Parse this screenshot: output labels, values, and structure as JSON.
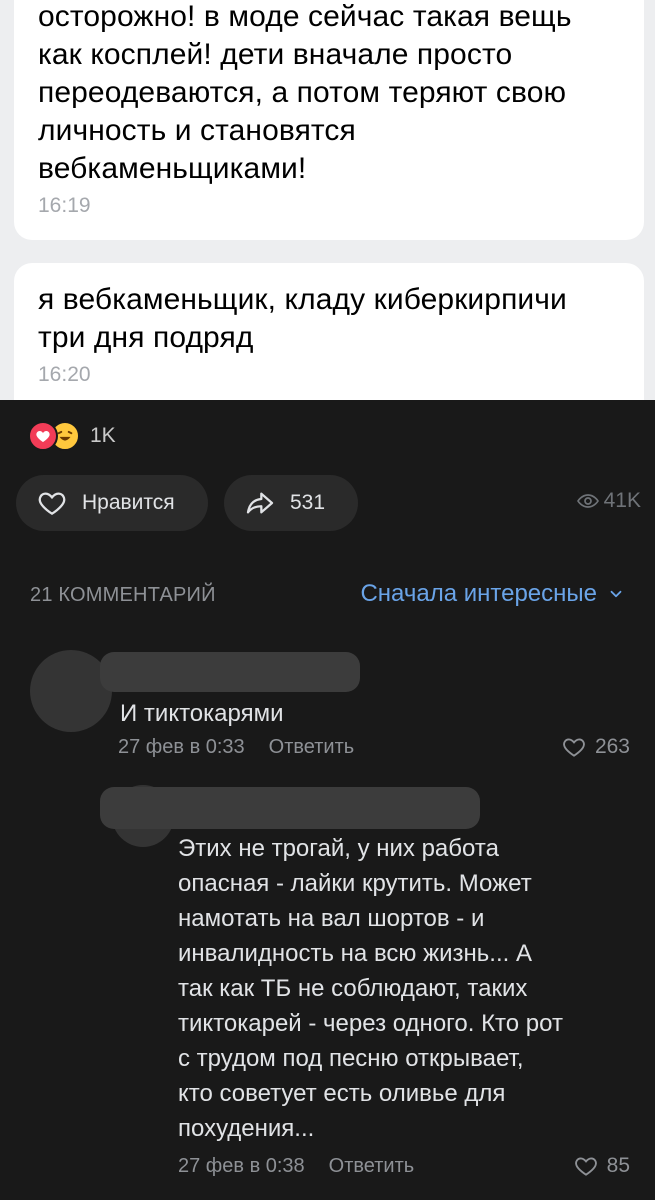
{
  "chat": {
    "messages": [
      {
        "lines": [
          "осторожно! в моде сейчас такая вещь",
          "как косплей! дети вначале просто",
          "переодеваются, а потом теряют свою",
          "личность и становятся",
          "вебкаменьщиками!"
        ],
        "time": "16:19"
      },
      {
        "lines": [
          "я вебкаменьщик, кладу киберкирпичи",
          "три дня подряд"
        ],
        "time": "16:20"
      }
    ]
  },
  "post": {
    "reactions_count": "1K",
    "like_label": "Нравится",
    "share_count": "531",
    "views": "41K"
  },
  "comments_section": {
    "count_label": "21 КОММЕНТАРИЙ",
    "sort_label": "Сначала интересные",
    "comments": [
      {
        "text": "И тиктокарями",
        "date": "27 фев в 0:33",
        "reply_label": "Ответить",
        "likes": "263"
      },
      {
        "lines": [
          "Этих не трогай, у них работа",
          "опасная - лайки крутить. Может",
          "намотать на вал шортов - и",
          "инвалидность на всю жизнь... А",
          "так как ТБ не соблюдают, таких",
          "тиктокарей - через одного. Кто рот",
          "с трудом под песню открывает,",
          "кто советует есть оливье для",
          "похудения..."
        ],
        "date": "27 фев в 0:38",
        "reply_label": "Ответить",
        "likes": "85"
      }
    ]
  },
  "colors": {
    "background": "#191919",
    "accent": "#6aa4e8",
    "heart_reaction": "#f23c57",
    "laugh_reaction": "#ffc83d"
  },
  "icons": [
    "heart-reaction-icon",
    "laugh-reaction-icon",
    "heart-icon",
    "share-icon",
    "eye-icon",
    "chevron-down-icon"
  ]
}
